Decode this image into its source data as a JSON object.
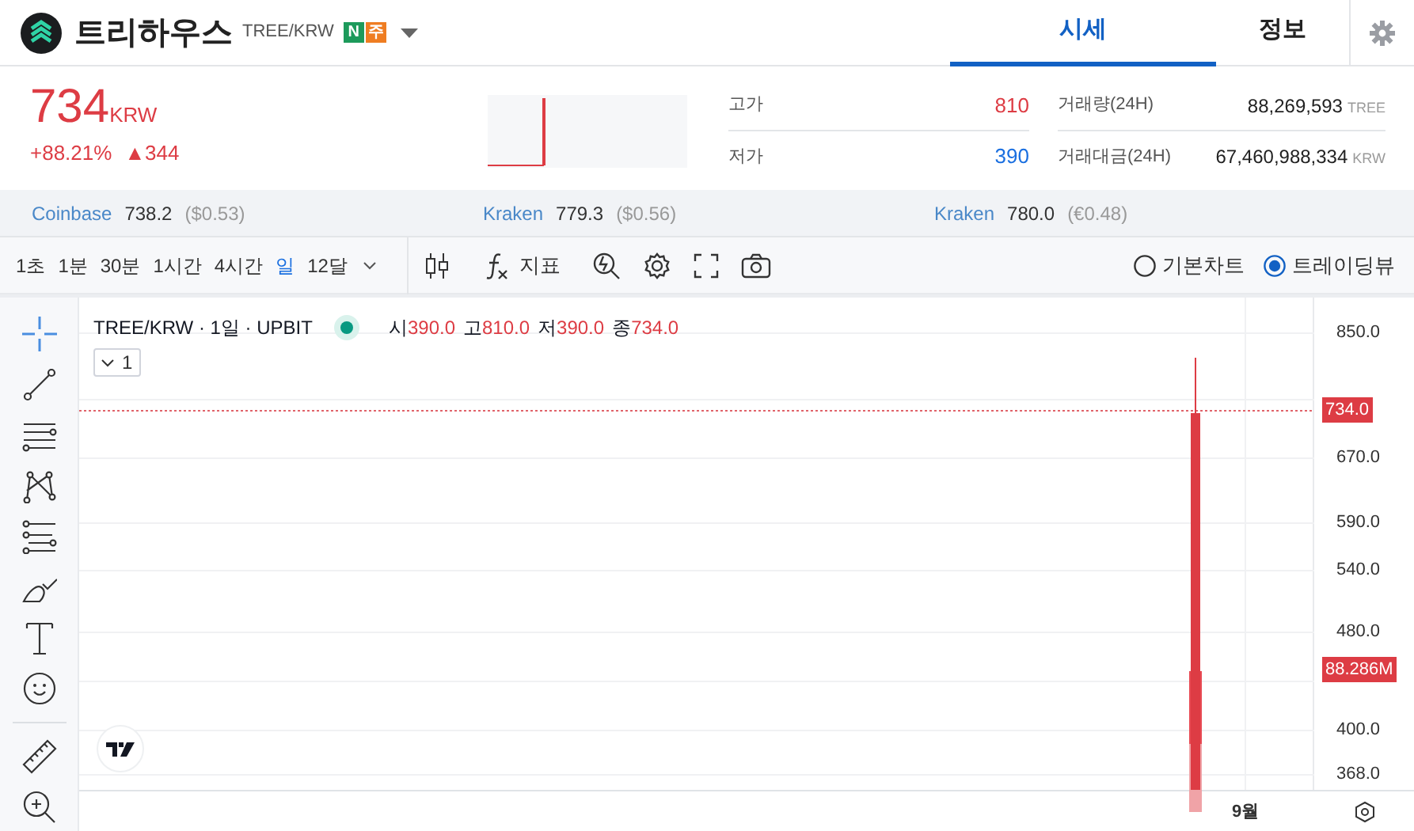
{
  "header": {
    "coin_name": "트리하우스",
    "pair": "TREE/KRW",
    "badges": [
      {
        "label": "N",
        "color": "#1d9a5b"
      },
      {
        "label": "주",
        "color": "#ef7d22"
      }
    ],
    "tabs": [
      {
        "label": "시세",
        "selected": true
      },
      {
        "label": "정보",
        "selected": false
      }
    ]
  },
  "ticker": {
    "price": "734",
    "currency": "KRW",
    "change_rate": "+88.21%",
    "change": "▲344"
  },
  "stats": [
    {
      "label": "고가",
      "value": "810",
      "kind": "high"
    },
    {
      "label": "저가",
      "value": "390",
      "kind": "low"
    }
  ],
  "volumes": [
    {
      "label": "거래량(24H)",
      "value": "88,269,593",
      "unit": "TREE"
    },
    {
      "label": "거래대금(24H)",
      "value": "67,460,988,334",
      "unit": "KRW"
    }
  ],
  "exchanges": [
    {
      "name": "Coinbase",
      "price": "738.2",
      "converted": "($0.53)"
    },
    {
      "name": "Kraken",
      "price": "779.3",
      "converted": "($0.56)"
    },
    {
      "name": "Kraken",
      "price": "780.0",
      "converted": "(€0.48)"
    }
  ],
  "intervals": [
    {
      "label": "1초",
      "selected": false
    },
    {
      "label": "1분",
      "selected": false
    },
    {
      "label": "30분",
      "selected": false
    },
    {
      "label": "1시간",
      "selected": false
    },
    {
      "label": "4시간",
      "selected": false
    },
    {
      "label": "일",
      "selected": true
    },
    {
      "label": "12달",
      "selected": false
    }
  ],
  "indicator_label": "지표",
  "chart_types": [
    {
      "label": "기본차트",
      "selected": false
    },
    {
      "label": "트레이딩뷰",
      "selected": true
    }
  ],
  "chart": {
    "legend_title": "TREE/KRW · 1일 · UPBIT",
    "ohlc": [
      {
        "label": "시",
        "value": "390.0"
      },
      {
        "label": "고",
        "value": "810.0"
      },
      {
        "label": "저",
        "value": "390.0"
      },
      {
        "label": "종",
        "value": "734.0"
      }
    ],
    "series_toggle": "1",
    "price_axis": [
      "850.0",
      "670.0",
      "590.0",
      "540.0",
      "480.0",
      "400.0",
      "368.0"
    ],
    "last_price_label": "734.0",
    "volume_label": "88.286M",
    "time_axis": [
      "9월"
    ]
  }
}
